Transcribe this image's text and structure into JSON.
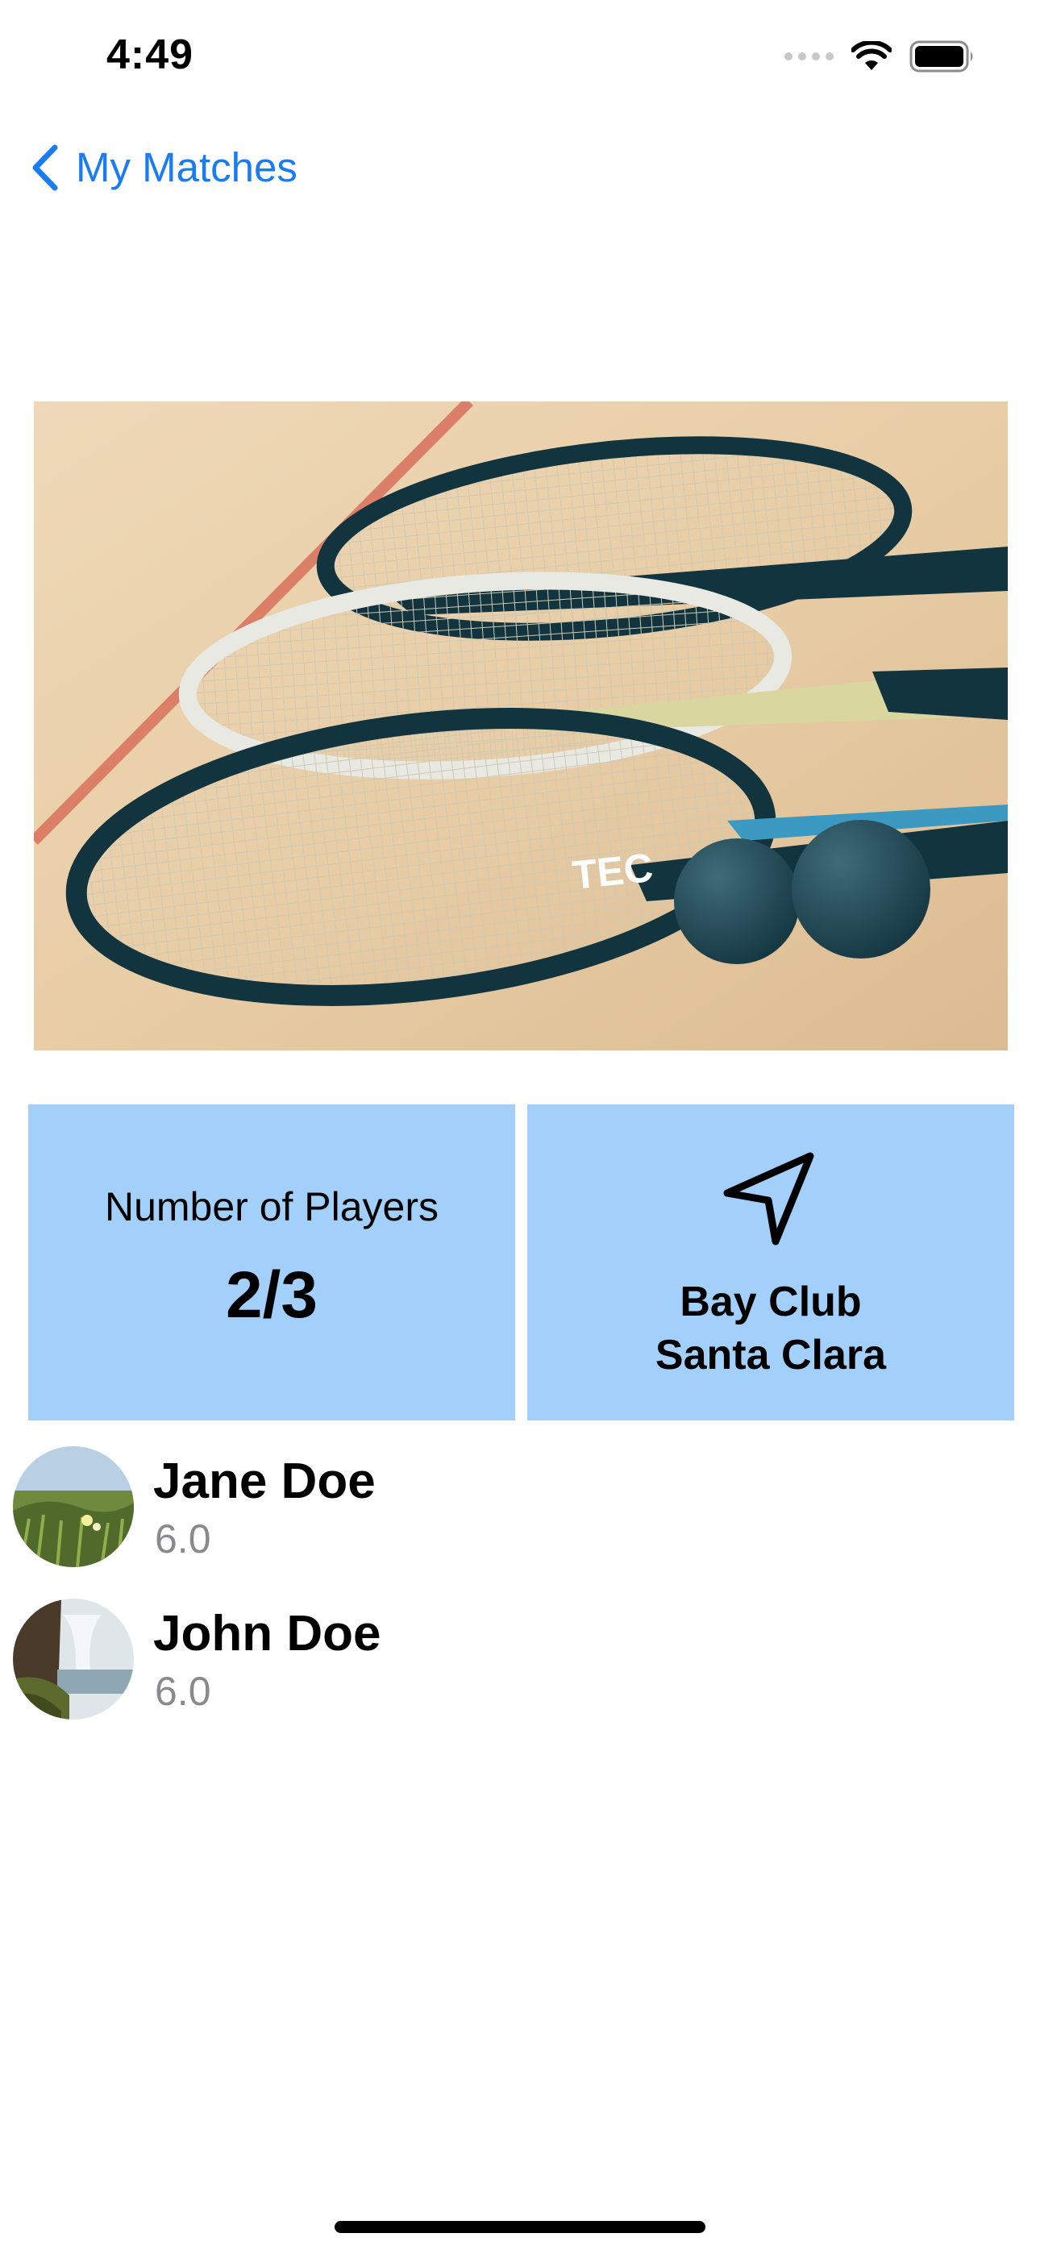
{
  "status_bar": {
    "time": "4:49",
    "icons": [
      "cellular-signal-icon",
      "wifi-icon",
      "battery-icon"
    ]
  },
  "nav": {
    "back_label": "My Matches",
    "back_icon": "chevron-left-icon",
    "accent_color": "#1a7cf2"
  },
  "hero_image": {
    "subject": "squash-rackets-and-balls-photo"
  },
  "players_card": {
    "label": "Number of Players",
    "count": "2/3",
    "background": "#a2d0fb"
  },
  "location_card": {
    "icon": "location-arrow-icon",
    "line1": "Bay Club",
    "line2": "Santa Clara",
    "background": "#a2d0fb"
  },
  "players": [
    {
      "name": "Jane Doe",
      "rating": "6.0",
      "avatar": "meadow-photo"
    },
    {
      "name": "John Doe",
      "rating": "6.0",
      "avatar": "waterfall-photo"
    }
  ]
}
